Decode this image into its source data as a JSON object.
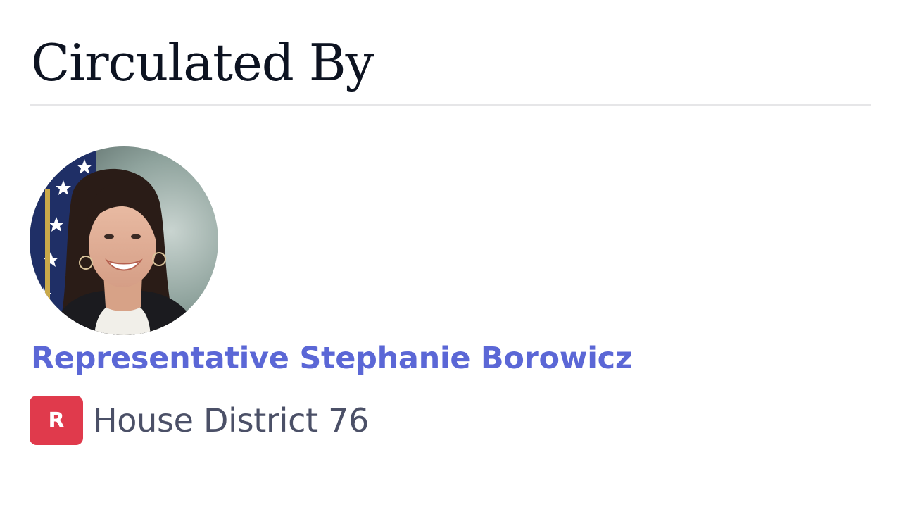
{
  "section": {
    "title": "Circulated By"
  },
  "sponsor": {
    "name": "Representative Stephanie Borowicz",
    "party_letter": "R",
    "district": "House District 76",
    "photo_icon": "portrait-photo",
    "colors": {
      "name_link": "#5b67d6",
      "party_badge": "#e03a4c",
      "district_text": "#4b5067",
      "title_text": "#0d1321"
    }
  }
}
